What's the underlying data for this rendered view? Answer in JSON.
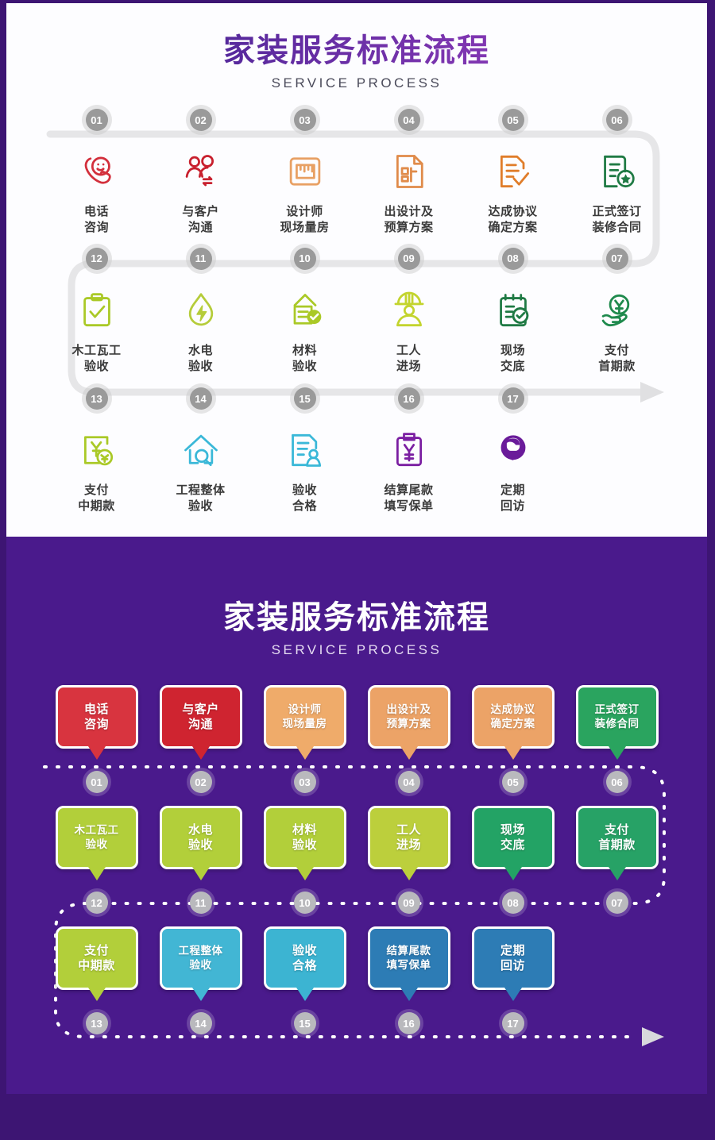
{
  "header": {
    "title_cn": "家装服务标准流程",
    "title_en": "SERVICE PROCESS"
  },
  "header_bottom": {
    "title_cn": "家装服务标准流程",
    "title_en": "SERVICE PROCESS"
  },
  "colors": {
    "page_border": "#3d1573",
    "panel_purple": "#4a1a8c",
    "title_gradient_start": "#2b1d8c",
    "title_gradient_end": "#9a3fc0",
    "number_circle": "#9a9a9a",
    "track_line": "#e4e4e6",
    "red": "#d32f3c",
    "crimson": "#c8202e",
    "sand": "#efab6a",
    "green": "#2aa45f",
    "yellowgreen": "#b2cf3a",
    "emerald": "#22a765",
    "cyan": "#3ab8d8",
    "steelblue": "#2d7cb5",
    "purple_icon": "#7b1fa2"
  },
  "steps": [
    {
      "num": "01",
      "label_l1": "电话",
      "label_l2": "咨询",
      "icon": "phone-smile-icon",
      "icon_color": "#d32f3c",
      "card_color": "#d8343f"
    },
    {
      "num": "02",
      "label_l1": "与客户",
      "label_l2": "沟通",
      "icon": "two-people-exchange-icon",
      "icon_color": "#c8202e",
      "card_color": "#cf2430"
    },
    {
      "num": "03",
      "label_l1": "设计师",
      "label_l2": "现场量房",
      "icon": "ruler-measure-icon",
      "icon_color": "#e8a063",
      "card_color": "#efab6a"
    },
    {
      "num": "04",
      "label_l1": "出设计及",
      "label_l2": "预算方案",
      "icon": "design-document-icon",
      "icon_color": "#e08b4a",
      "card_color": "#eca367"
    },
    {
      "num": "05",
      "label_l1": "达成协议",
      "label_l2": "确定方案",
      "icon": "agreement-check-icon",
      "icon_color": "#e07d2a",
      "card_color": "#eca367"
    },
    {
      "num": "06",
      "label_l1": "正式签订",
      "label_l2": "装修合同",
      "icon": "contract-star-icon",
      "icon_color": "#1f7a44",
      "card_color": "#2aa45f"
    },
    {
      "num": "07",
      "label_l1": "支付",
      "label_l2": "首期款",
      "icon": "hand-yuan-icon",
      "icon_color": "#1f8a4d",
      "card_color": "#27a266"
    },
    {
      "num": "08",
      "label_l1": "现场",
      "label_l2": "交底",
      "icon": "clipboard-check-icon",
      "icon_color": "#1f7a44",
      "card_color": "#23a365"
    },
    {
      "num": "09",
      "label_l1": "工人",
      "label_l2": "进场",
      "icon": "worker-helmet-icon",
      "icon_color": "#c3d42e",
      "card_color": "#bccf3c"
    },
    {
      "num": "10",
      "label_l1": "材料",
      "label_l2": "验收",
      "icon": "material-check-icon",
      "icon_color": "#aac927",
      "card_color": "#b2cf3a"
    },
    {
      "num": "11",
      "label_l1": "水电",
      "label_l2": "验收",
      "icon": "water-power-icon",
      "icon_color": "#b5cc3a",
      "card_color": "#b2cf3a"
    },
    {
      "num": "12",
      "label_l1": "木工瓦工",
      "label_l2": "验收",
      "icon": "clipboard-tick-icon",
      "icon_color": "#aac927",
      "card_color": "#b2cf3a"
    },
    {
      "num": "13",
      "label_l1": "支付",
      "label_l2": "中期款",
      "icon": "yuan-payment-icon",
      "icon_color": "#aac927",
      "card_color": "#b2cf3a"
    },
    {
      "num": "14",
      "label_l1": "工程整体",
      "label_l2": "验收",
      "icon": "house-search-icon",
      "icon_color": "#3ab8d8",
      "card_color": "#42b6d4"
    },
    {
      "num": "15",
      "label_l1": "验收",
      "label_l2": "合格",
      "icon": "document-person-icon",
      "icon_color": "#3ab8d8",
      "card_color": "#3cb4d2"
    },
    {
      "num": "16",
      "label_l1": "结算尾款",
      "label_l2": "填写保单",
      "icon": "clipboard-yuan-icon",
      "icon_color": "#7b1fa2",
      "card_color": "#2d7cb5"
    },
    {
      "num": "17",
      "label_l1": "定期",
      "label_l2": "回访",
      "icon": "headset-agent-icon",
      "icon_color": "#6a1b9a",
      "card_color": "#2d7cb5"
    }
  ],
  "row_order": {
    "row1": [
      "01",
      "02",
      "03",
      "04",
      "05",
      "06"
    ],
    "row2": [
      "12",
      "11",
      "10",
      "09",
      "08",
      "07"
    ],
    "row3": [
      "13",
      "14",
      "15",
      "16",
      "17"
    ]
  },
  "arrow": {
    "name": "flow-end-arrow"
  }
}
